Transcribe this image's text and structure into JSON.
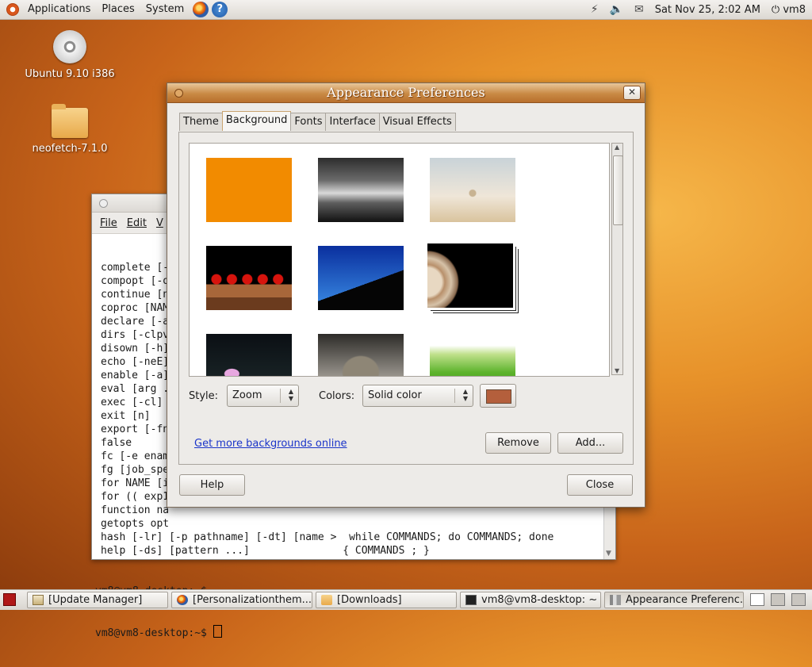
{
  "top_panel": {
    "menus": [
      "Applications",
      "Places",
      "System"
    ],
    "clock": "Sat Nov 25,  2:02 AM",
    "user": "vm8",
    "power_glyph": "⏻",
    "help_glyph": "?"
  },
  "desktop_icons": [
    {
      "label": "Ubuntu 9.10 i386",
      "icon": "cd-icon"
    },
    {
      "label": "neofetch-7.1.0",
      "icon": "folder-icon"
    }
  ],
  "terminal": {
    "menus": [
      "File",
      "Edit",
      "V"
    ],
    "lines": [
      "complete [-",
      "compopt [-o",
      "continue [n",
      "coproc [NAM",
      "declare [-a",
      "dirs [-clpv",
      "disown [-h]",
      "echo [-neE]",
      "enable [-a]",
      "eval [arg .",
      "exec [-cl]",
      "exit [n]",
      "export [-fn",
      "false",
      "fc [-e enam",
      "fg [job_spe",
      "for NAME [i",
      "for (( exp1",
      "function na",
      "getopts opt",
      "hash [-lr] [-p pathname] [-dt] [name >  while COMMANDS; do COMMANDS; done",
      "help [-ds] [pattern ...]               { COMMANDS ; }"
    ],
    "prompt1": "vm8@vm8-desktop:~$",
    "prompt2": "vm8@vm8-desktop:~$ "
  },
  "dialog": {
    "title": "Appearance Preferences",
    "close_glyph": "✕",
    "tabs": [
      "Theme",
      "Background",
      "Fonts",
      "Interface",
      "Visual Effects"
    ],
    "active_tab": "Background",
    "style_label": "Style:",
    "style_value": "Zoom",
    "colors_label": "Colors:",
    "colors_value": "Solid color",
    "swatch_color": "#b45f3c",
    "link": "Get more backgrounds online",
    "remove": "Remove",
    "add": "Add...",
    "help": "Help",
    "close": "Close"
  },
  "taskbar": [
    {
      "label": "[Update Manager]",
      "icon": "update-manager-icon"
    },
    {
      "label": "[Personalizationthem...",
      "icon": "firefox-icon"
    },
    {
      "label": "[Downloads]",
      "icon": "folder-icon"
    },
    {
      "label": "vm8@vm8-desktop: ~",
      "icon": "terminal-icon"
    },
    {
      "label": "Appearance Preferenc...",
      "icon": "appearance-icon"
    }
  ]
}
